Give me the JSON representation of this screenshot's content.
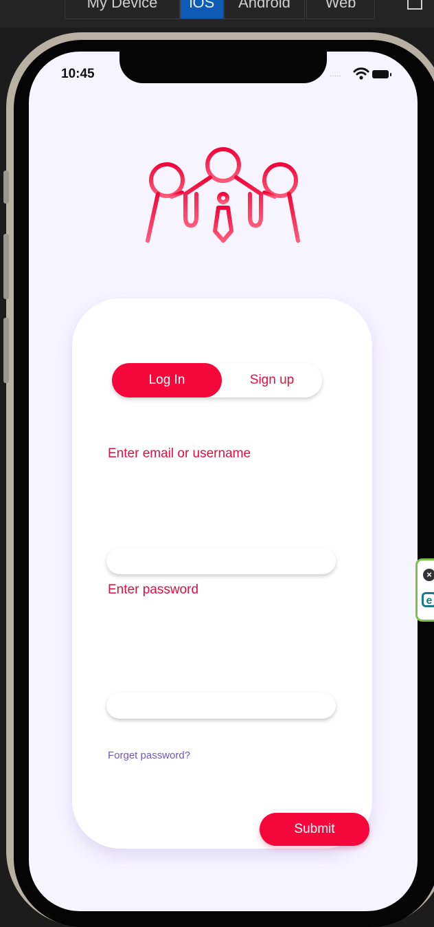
{
  "toolbar": {
    "segments": [
      "My Device",
      "iOS",
      "Android",
      "Web"
    ],
    "active_segment": "iOS"
  },
  "status_bar": {
    "time": "10:45",
    "icons": [
      "signal-dots-icon",
      "wifi-icon",
      "battery-icon"
    ]
  },
  "logo": {
    "icon": "team-people-icon",
    "color": "#f5073c"
  },
  "auth_toggle": {
    "login_label": "Log In",
    "signup_label": "Sign up",
    "active": "Log In"
  },
  "form": {
    "email_label": "Enter email or username",
    "email_value": "",
    "password_label": "Enter password",
    "password_value": "",
    "forgot_label": "Forget password?",
    "submit_label": "Submit"
  },
  "colors": {
    "accent": "#f5073c",
    "label": "#e50c3f",
    "link": "#6e58c2",
    "screen_bg": "#f6f4fe"
  }
}
